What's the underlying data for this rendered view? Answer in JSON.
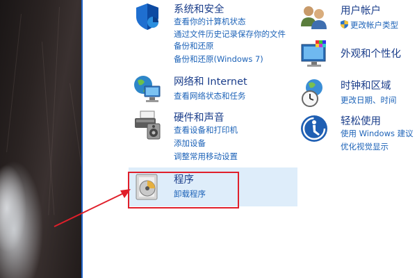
{
  "left": {
    "system": {
      "title": "系统和安全",
      "links": [
        "查看你的计算机状态",
        "通过文件历史记录保存你的文件",
        "备份和还原",
        "备份和还原(Windows 7)"
      ]
    },
    "network": {
      "title": "网络和 Internet",
      "links": [
        "查看网络状态和任务"
      ]
    },
    "hardware": {
      "title": "硬件和声音",
      "links": [
        "查看设备和打印机",
        "添加设备",
        "调整常用移动设置"
      ]
    },
    "programs": {
      "title": "程序",
      "links": [
        "卸载程序"
      ]
    }
  },
  "right": {
    "users": {
      "title": "用户帐户",
      "links": [
        "更改帐户类型"
      ]
    },
    "appearance": {
      "title": "外观和个性化",
      "links": []
    },
    "clock": {
      "title": "时钟和区域",
      "links": [
        "更改日期、时间"
      ]
    },
    "ease": {
      "title": "轻松使用",
      "links": [
        "使用 Windows 建议",
        "优化视觉显示"
      ]
    }
  },
  "colors": {
    "title": "#1a3d8a",
    "link": "#1d63b8",
    "highlight": "#deedfa",
    "annotation": "#e01f2a"
  }
}
